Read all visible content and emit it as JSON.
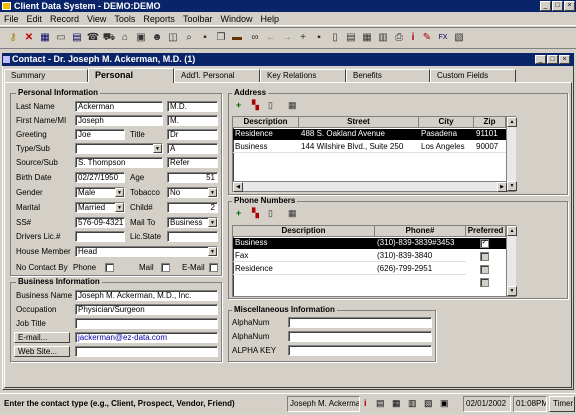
{
  "app": {
    "title": "Client Data System - DEMO:DEMO"
  },
  "menu": [
    "File",
    "Edit",
    "Record",
    "View",
    "Tools",
    "Reports",
    "Toolbar",
    "Window",
    "Help"
  ],
  "toolbar_icons": [
    "key-icon",
    "delete-icon",
    "grid-icon",
    "ruler-icon",
    "card-icon",
    "phone-book-icon",
    "car-icon",
    "home-icon",
    "clipboard-icon",
    "people-icon",
    "rolodex-icon",
    "search-binoculars-icon",
    "save-icon",
    "copy-icon",
    "briefcase-icon",
    "info-icon",
    "pencil-icon",
    "calculator-icon",
    "calendar-icon",
    "phone-icon",
    "email-icon",
    "letter-icon",
    "binoculars-icon",
    "arrow-left-icon",
    "arrow-right-icon",
    "plus-icon",
    "minus-icon",
    "floppy-icon",
    "print-icon",
    "trash-icon",
    "document-icon",
    "table-icon",
    "notes-icon",
    "info-i-icon",
    "fax-icon",
    "paste-icon"
  ],
  "child": {
    "title": "Contact - Dr. Joseph M. Ackerman, M.D. (1)"
  },
  "tabs": [
    "Summary",
    "Personal",
    "Add'l. Personal",
    "Key Relations",
    "Benefits",
    "Custom Fields"
  ],
  "personal": {
    "group_label": "Personal Information",
    "last_name_label": "Last Name",
    "last_name": "Ackerman",
    "suffix": "M.D.",
    "first_name_label": "First Name/MI",
    "first_name": "Joseph",
    "mi": "M.",
    "greeting_label": "Greeting",
    "greeting": "Joe",
    "title_label": "Title",
    "title": "Dr",
    "type_label": "Type/Sub",
    "type": "",
    "sub": "A",
    "source_label": "Source/Sub",
    "source": "S. Thompson",
    "source_sub": "Refer",
    "birth_label": "Birth Date",
    "birth": "02/27/1950",
    "age_label": "Age",
    "age": "51",
    "gender_label": "Gender",
    "gender": "Male",
    "tobacco_label": "Tobacco",
    "tobacco": "No",
    "marital_label": "Marital",
    "marital": "Married",
    "child_label": "Child#",
    "child": "2",
    "ss_label": "SS#",
    "ss": "576-09-4321",
    "mailto_label": "Mail To",
    "mailto": "Business",
    "lic_label": "Drivers Lic.#",
    "lic": "",
    "licstate_label": "Lic.State",
    "licstate": "",
    "house_label": "House Member",
    "house": "Head",
    "nocontact_label": "No Contact By",
    "phone_label": "Phone",
    "mail_label": "Mail",
    "email_label": "E-Mail"
  },
  "business": {
    "group_label": "Business Information",
    "name_label": "Business Name",
    "name": "Joseph M. Ackerman, M.D., Inc.",
    "occ_label": "Occupation",
    "occ": "Physician/Surgeon",
    "job_label": "Job Title",
    "job": "",
    "email_btn": "E-mail...",
    "email": "jackerman@ez-data.com",
    "web_btn": "Web Site...",
    "web": ""
  },
  "address": {
    "group_label": "Address",
    "columns": [
      "Description",
      "Street",
      "City",
      "Zip"
    ],
    "rows": [
      [
        "Residence",
        "488 S. Oakland Avenue",
        "Pasadena",
        "91101"
      ],
      [
        "Business",
        "144 Wilshire Blvd., Suite 250",
        "Los Angeles",
        "90007"
      ]
    ]
  },
  "phones": {
    "group_label": "Phone Numbers",
    "columns": [
      "Description",
      "Phone#",
      "Preferred"
    ],
    "rows": [
      [
        "Business",
        "(310)-839-3839#3453"
      ],
      [
        "Fax",
        "(310)-839-3840"
      ],
      [
        "Residence",
        "(626)-799-2951"
      ]
    ]
  },
  "misc": {
    "group_label": "Miscellaneous Information",
    "l1": "AlphaNum",
    "l2": "AlphaNum",
    "l3": "ALPHA KEY"
  },
  "status": {
    "hint": "Enter the contact type (e.g., Client, Prospect, Vendor, Friend)",
    "contact": "Joseph M. Ackerman",
    "date": "02/01/2002",
    "time": "01:08PM",
    "timer": "Timer"
  }
}
